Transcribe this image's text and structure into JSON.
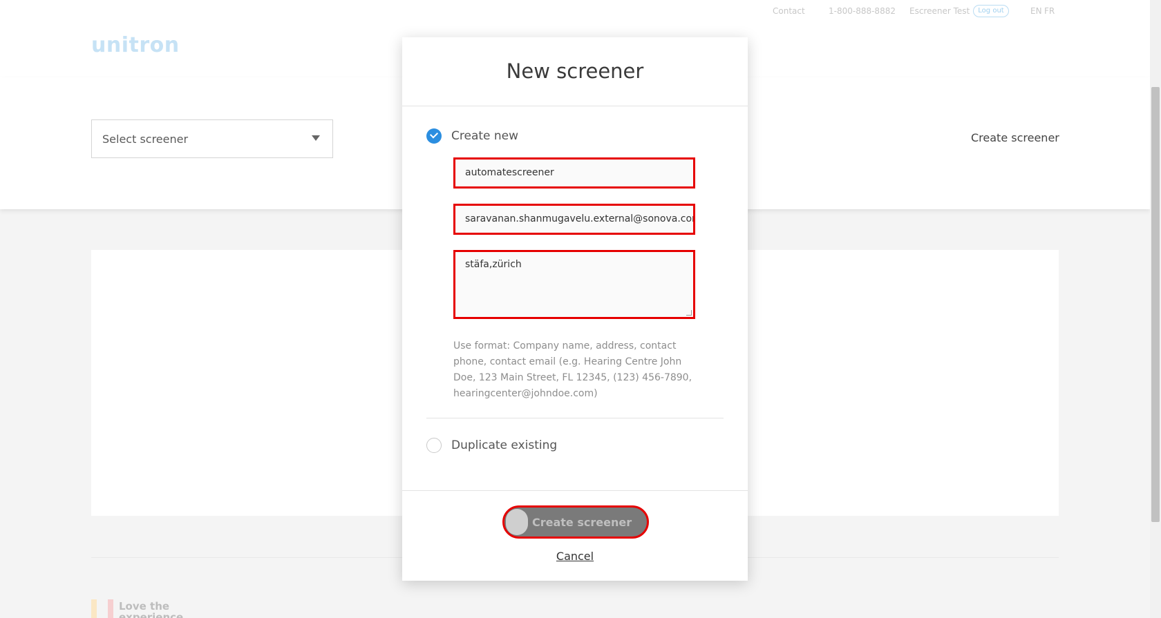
{
  "header": {
    "contact": "Contact",
    "phone": "1-800-888-8882",
    "user": "Escreener Test",
    "logout": "Log out",
    "lang_en": "EN",
    "lang_fr": "FR",
    "logo": "unitron"
  },
  "toolbar": {
    "select_placeholder": "Select screener",
    "create_link": "Create screener"
  },
  "footer": {
    "badge_text": "Love the experience"
  },
  "modal": {
    "title": "New screener",
    "option_create": "Create new",
    "option_duplicate": "Duplicate existing",
    "name_value": "automatescreener",
    "email_value": "saravanan.shanmugavelu.external@sonova.com",
    "address_value": "stäfa,zürich",
    "hint": "Use format: Company name, address, contact phone, contact email (e.g. Hearing Centre John Doe, 123 Main Street, FL 12345, (123) 456-7890, hearingcenter@johndoe.com)",
    "create_button": "Create screener",
    "cancel": "Cancel"
  },
  "colors": {
    "accent": "#2b8ee0",
    "highlight_border": "#e60000",
    "button_bg": "#7a7a7a"
  }
}
